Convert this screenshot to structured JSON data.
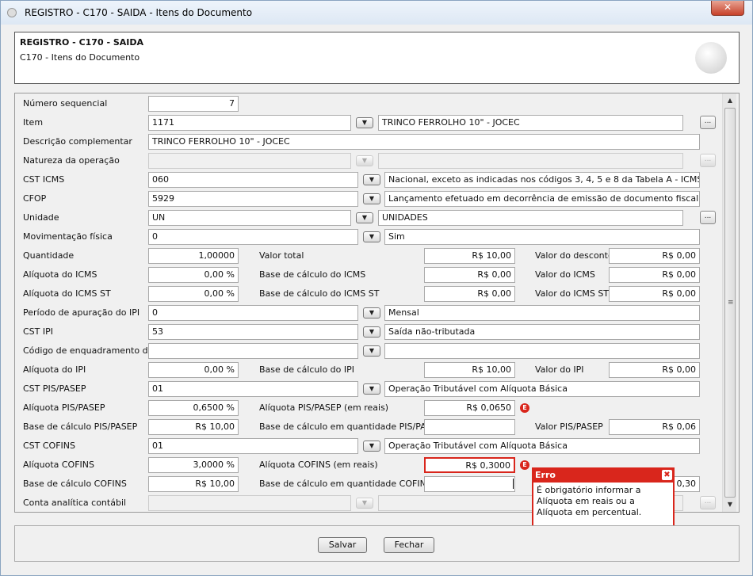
{
  "window": {
    "title": "REGISTRO - C170 - SAIDA - Itens do Documento",
    "close_label": "✕"
  },
  "header": {
    "title": "REGISTRO - C170 - SAIDA",
    "subtitle": "C170 - Itens do Documento"
  },
  "fields": {
    "numero_seq": {
      "label": "Número sequencial",
      "value": "7"
    },
    "item": {
      "label": "Item",
      "code": "1171",
      "desc": "TRINCO FERROLHO 10\" - JOCEC"
    },
    "desc_compl": {
      "label": "Descrição complementar",
      "value": "TRINCO FERROLHO 10\" - JOCEC"
    },
    "natureza": {
      "label": "Natureza da operação",
      "code": "",
      "desc": ""
    },
    "cst_icms": {
      "label": "CST ICMS",
      "code": "060",
      "desc": "Nacional, exceto as indicadas nos códigos 3, 4, 5 e 8 da Tabela A - ICMS cobrado"
    },
    "cfop": {
      "label": "CFOP",
      "code": "5929",
      "desc": "Lançamento efetuado em decorrência de emissão de documento fiscal relativo a"
    },
    "unidade": {
      "label": "Unidade",
      "code": "UN",
      "desc": "UNIDADES"
    },
    "mov_fisica": {
      "label": "Movimentação física",
      "code": "0",
      "desc": "Sim"
    },
    "quantidade": {
      "label": "Quantidade",
      "value": "1,00000"
    },
    "valor_total": {
      "label": "Valor total",
      "value": "R$ 10,00"
    },
    "valor_desconto": {
      "label": "Valor do desconto",
      "value": "R$ 0,00"
    },
    "aliq_icms": {
      "label": "Alíquota do ICMS",
      "value": "0,00 %"
    },
    "base_icms": {
      "label": "Base de cálculo do ICMS",
      "value": "R$ 0,00"
    },
    "valor_icms": {
      "label": "Valor do ICMS",
      "value": "R$ 0,00"
    },
    "aliq_icms_st": {
      "label": "Alíquota do ICMS ST",
      "value": "0,00 %"
    },
    "base_icms_st": {
      "label": "Base de cálculo do ICMS ST",
      "value": "R$ 0,00"
    },
    "valor_icms_st": {
      "label": "Valor do ICMS ST",
      "value": "R$ 0,00"
    },
    "periodo_ipi": {
      "label": "Período de apuração do IPI",
      "code": "0",
      "desc": "Mensal"
    },
    "cst_ipi": {
      "label": "CST IPI",
      "code": "53",
      "desc": "Saída não-tributada"
    },
    "cod_enq_ipi": {
      "label": "Código de enquadramento do IPI",
      "code": "",
      "desc": ""
    },
    "aliq_ipi": {
      "label": "Alíquota do IPI",
      "value": "0,00 %"
    },
    "base_ipi": {
      "label": "Base de cálculo do IPI",
      "value": "R$ 10,00"
    },
    "valor_ipi": {
      "label": "Valor do IPI",
      "value": "R$ 0,00"
    },
    "cst_pis": {
      "label": "CST PIS/PASEP",
      "code": "01",
      "desc": "Operação Tributável com Alíquota Básica"
    },
    "aliq_pis": {
      "label": "Alíquota PIS/PASEP",
      "value": "0,6500 %"
    },
    "aliq_pis_reais": {
      "label": "Alíquota PIS/PASEP (em reais)",
      "value": "R$ 0,0650"
    },
    "base_pis": {
      "label": "Base de cálculo PIS/PASEP",
      "value": "R$ 10,00"
    },
    "base_qtd_pis": {
      "label": "Base de cálculo em quantidade PIS/PASEP",
      "value": ""
    },
    "valor_pis": {
      "label": "Valor PIS/PASEP",
      "value": "R$ 0,06"
    },
    "cst_cofins": {
      "label": "CST COFINS",
      "code": "01",
      "desc": "Operação Tributável com Alíquota Básica"
    },
    "aliq_cofins": {
      "label": "Alíquota COFINS",
      "value": "3,0000 %"
    },
    "aliq_cofins_reais": {
      "label": "Alíquota COFINS (em reais)",
      "value": "R$ 0,3000"
    },
    "base_cofins": {
      "label": "Base de cálculo COFINS",
      "value": "R$ 10,00"
    },
    "base_qtd_cofins": {
      "label": "Base de cálculo em quantidade COFINS",
      "value": ""
    },
    "valor_cofins_partial": {
      "value": "0,30"
    },
    "conta_contabil": {
      "label": "Conta analítica contábil",
      "code": "",
      "desc": ""
    }
  },
  "icons": {
    "dropdown": "▼",
    "ellipsis": "...",
    "error_badge": "E",
    "scroll_up": "▲",
    "scroll_down": "▼",
    "scroll_grip": "≡"
  },
  "error_tooltip": {
    "title": "Erro",
    "close": "✖",
    "message": "É obrigatório informar a Alíquota em reais ou a Alíquota em percentual."
  },
  "buttons": {
    "save": "Salvar",
    "cancel": "Fechar"
  },
  "colors": {
    "error": "#d9261c"
  }
}
